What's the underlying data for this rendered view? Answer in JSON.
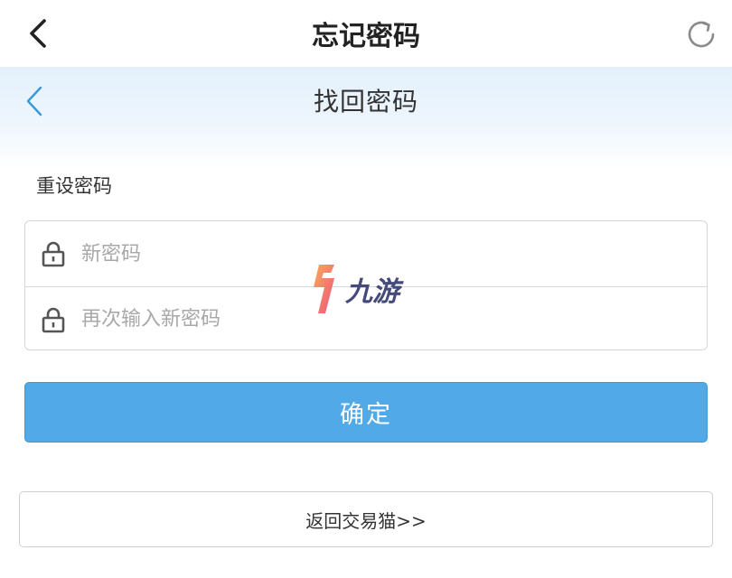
{
  "appbar": {
    "title": "忘记密码",
    "back_icon": "chevron-left-icon",
    "refresh_icon": "refresh-icon"
  },
  "subheader": {
    "title": "找回密码",
    "back_icon": "chevron-left-icon"
  },
  "form": {
    "section_label": "重设密码",
    "new_password": {
      "value": "",
      "placeholder": "新密码",
      "icon": "lock-icon"
    },
    "confirm_password": {
      "value": "",
      "placeholder": "再次输入新密码",
      "icon": "lock-icon"
    },
    "confirm_label": "确定"
  },
  "footer": {
    "return_label": "返回交易猫>>"
  },
  "watermark": {
    "text": "九游"
  },
  "colors": {
    "accent": "#51a9e7",
    "back_link": "#3a9ad9",
    "border": "#d6d6d6"
  }
}
